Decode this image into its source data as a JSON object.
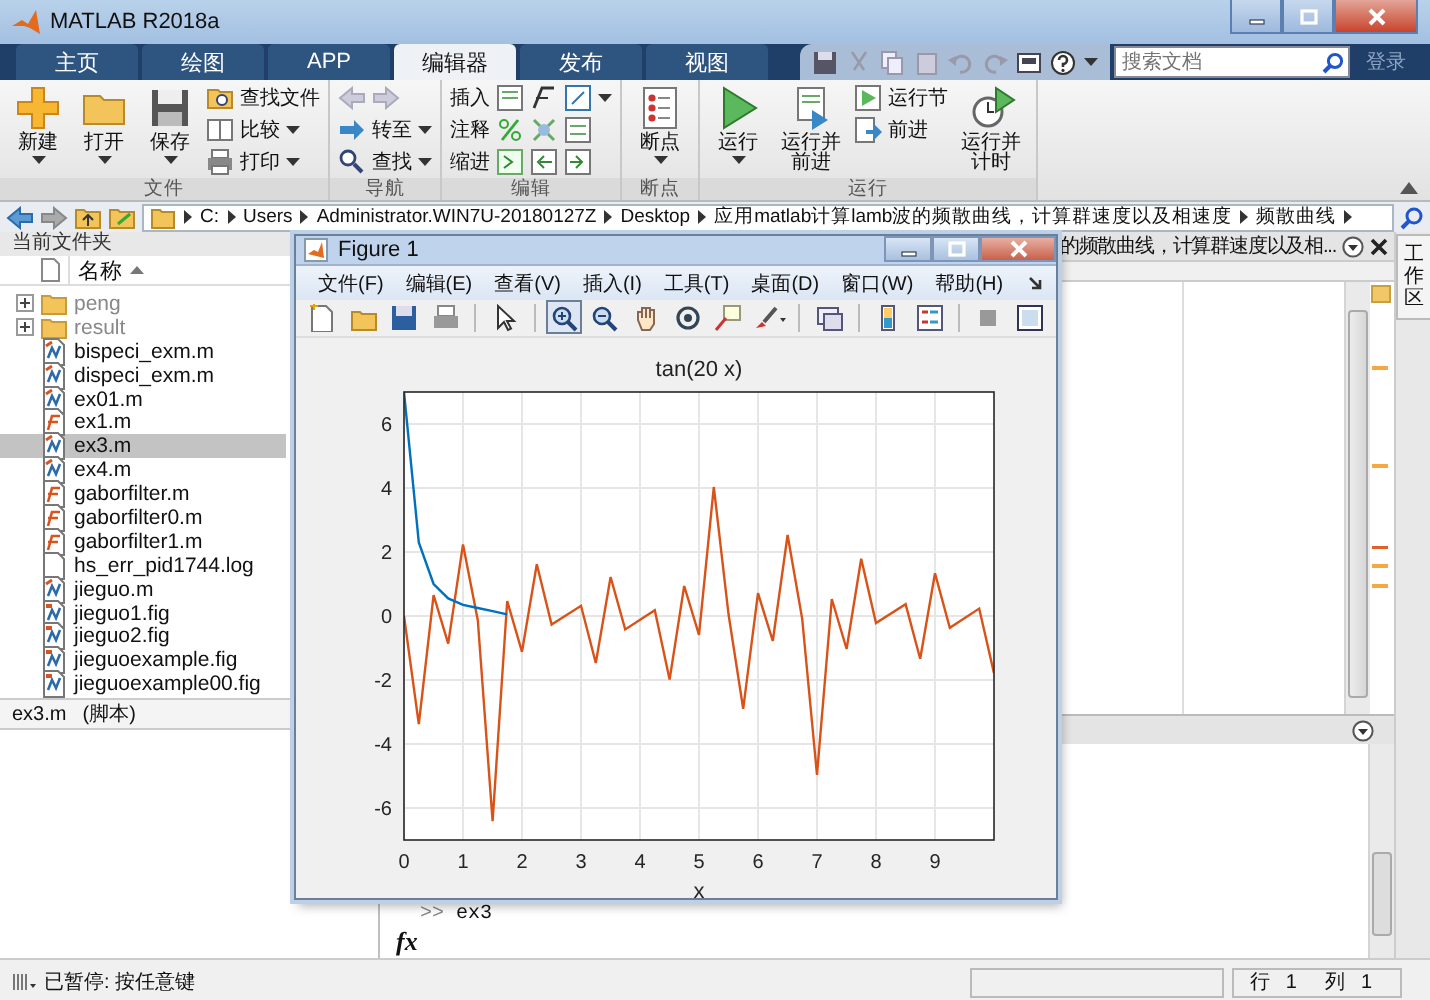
{
  "window": {
    "title": "MATLAB R2018a"
  },
  "tabs": [
    {
      "label": "主页",
      "selected": false
    },
    {
      "label": "绘图",
      "selected": false
    },
    {
      "label": "APP",
      "selected": false
    },
    {
      "label": "编辑器",
      "selected": true
    },
    {
      "label": "发布",
      "selected": false
    },
    {
      "label": "视图",
      "selected": false
    }
  ],
  "search": {
    "placeholder": "搜索文档"
  },
  "sign_in": "登录",
  "ribbon": [
    {
      "label": "文件",
      "items": [
        {
          "kind": "large",
          "label": "新建",
          "dropdown": true
        },
        {
          "kind": "large",
          "label": "打开",
          "dropdown": true
        },
        {
          "kind": "large",
          "label": "保存",
          "dropdown": true
        },
        {
          "kind": "small",
          "label": "查找文件",
          "dropdown": false
        },
        {
          "kind": "small",
          "label": "比较",
          "dropdown": true
        },
        {
          "kind": "small",
          "label": "打印",
          "dropdown": true
        }
      ]
    },
    {
      "label": "导航",
      "items": [
        {
          "kind": "arrows"
        },
        {
          "kind": "small",
          "label": "转至",
          "dropdown": true
        },
        {
          "kind": "small",
          "label": "查找",
          "dropdown": true
        }
      ]
    },
    {
      "label": "编辑",
      "items": [
        {
          "kind": "tools",
          "label": "插入",
          "dropdown": true
        },
        {
          "kind": "tools",
          "label": "注释",
          "dropdown": false
        },
        {
          "kind": "tools",
          "label": "缩进",
          "dropdown": false
        }
      ]
    },
    {
      "label": "断点",
      "items": [
        {
          "kind": "large",
          "label": "断点",
          "dropdown": true
        }
      ]
    },
    {
      "label": "运行",
      "items": [
        {
          "kind": "large",
          "label": "运行",
          "dropdown": true
        },
        {
          "kind": "large",
          "label": "运行并前进",
          "dropdown": false
        },
        {
          "kind": "small",
          "label": "运行节",
          "dropdown": false
        },
        {
          "kind": "small",
          "label": "前进",
          "dropdown": false
        },
        {
          "kind": "large",
          "label": "运行并计时",
          "dropdown": false
        }
      ]
    }
  ],
  "address_bar": {
    "path": [
      "C:",
      "Users",
      "Administrator.WIN7U-20180127Z",
      "Desktop",
      "应用matlab计算lamb波的频散曲线，计算群速度以及相速度",
      "频散曲线"
    ]
  },
  "current_folder": {
    "title": "当前文件夹",
    "column": "名称",
    "files": [
      {
        "name": "peng",
        "kind": "folder",
        "selected": false
      },
      {
        "name": "result",
        "kind": "folder",
        "selected": false
      },
      {
        "name": "bispeci_exm.m",
        "kind": "script",
        "selected": false
      },
      {
        "name": "dispeci_exm.m",
        "kind": "script",
        "selected": false
      },
      {
        "name": "ex01.m",
        "kind": "script",
        "selected": false
      },
      {
        "name": "ex1.m",
        "kind": "function",
        "selected": false
      },
      {
        "name": "ex3.m",
        "kind": "script",
        "selected": true
      },
      {
        "name": "ex4.m",
        "kind": "script",
        "selected": false
      },
      {
        "name": "gaborfilter.m",
        "kind": "function",
        "selected": false
      },
      {
        "name": "gaborfilter0.m",
        "kind": "function",
        "selected": false
      },
      {
        "name": "gaborfilter1.m",
        "kind": "function",
        "selected": false
      },
      {
        "name": "hs_err_pid1744.log",
        "kind": "text",
        "selected": false
      },
      {
        "name": "jieguo.m",
        "kind": "script",
        "selected": false
      },
      {
        "name": "jieguo1.fig",
        "kind": "figure",
        "selected": false
      },
      {
        "name": "jieguo2.fig",
        "kind": "figure",
        "selected": false
      },
      {
        "name": "jieguoexample.fig",
        "kind": "figure",
        "selected": false
      },
      {
        "name": "jieguoexample00.fig",
        "kind": "figure",
        "selected": false
      }
    ],
    "details": {
      "name": "ex3.m",
      "type": "(脚本)"
    }
  },
  "editor": {
    "tab_title": "的频散曲线，计算群速度以及相..."
  },
  "workspace_tab": "工作区",
  "command_window": {
    "prompt": ">>",
    "command": "ex3",
    "fx": "fx"
  },
  "status_bar": {
    "message": "已暂停: 按任意键",
    "row_label": "行",
    "row": "1",
    "col_label": "列",
    "col": "1"
  },
  "figure": {
    "title": "Figure 1",
    "menus": [
      "文件(F)",
      "编辑(E)",
      "查看(V)",
      "插入(I)",
      "工具(T)",
      "桌面(D)",
      "窗口(W)",
      "帮助(H)"
    ],
    "toolbar": [
      [
        {
          "kind": "new",
          "pressed": false
        },
        {
          "kind": "open",
          "pressed": false
        },
        {
          "kind": "save",
          "pressed": false
        },
        {
          "kind": "print",
          "pressed": false
        }
      ],
      [
        {
          "kind": "pointer",
          "pressed": false
        }
      ],
      [
        {
          "kind": "zoom_in",
          "pressed": true
        },
        {
          "kind": "zoom_out",
          "pressed": false
        },
        {
          "kind": "pan",
          "pressed": false
        },
        {
          "kind": "rotate",
          "pressed": false
        },
        {
          "kind": "data_cursor",
          "pressed": false
        },
        {
          "kind": "brush",
          "pressed": false
        }
      ],
      [
        {
          "kind": "link",
          "pressed": false
        }
      ],
      [
        {
          "kind": "colorbar",
          "pressed": false
        },
        {
          "kind": "legend",
          "pressed": false
        }
      ],
      [
        {
          "kind": "hide_tools",
          "pressed": false
        },
        {
          "kind": "show_tools",
          "pressed": false
        }
      ]
    ],
    "chart_data": {
      "type": "line",
      "title": "tan(20 x)",
      "xlabel": "x",
      "x": [
        0,
        0.25,
        0.5,
        0.75,
        1,
        1.25,
        1.5,
        1.75,
        2,
        2.25,
        2.5,
        3,
        3.25,
        3.5,
        3.75,
        4.25,
        4.5,
        4.75,
        5,
        5.25,
        5.5,
        5.75,
        6,
        6.25,
        6.5,
        6.75,
        7,
        7.25,
        7.5,
        7.75,
        8,
        8.5,
        8.75,
        9,
        9.25,
        9.75,
        10
      ],
      "series": [
        {
          "color": "#d95319",
          "values": [
            0,
            -3.38,
            0.65,
            -0.86,
            2.24,
            -0.13,
            -6.41,
            0.47,
            -1.12,
            1.62,
            -0.27,
            0.32,
            -1.47,
            1.22,
            -0.42,
            0.18,
            -1.99,
            0.94,
            -0.59,
            4.03,
            0.04,
            -2.9,
            0.71,
            -0.78,
            2.53,
            -0.09,
            -4.96,
            0.53,
            -1.03,
            1.79,
            -0.22,
            0.37,
            -1.34,
            1.34,
            -0.37,
            0.23,
            -1.79
          ]
        },
        {
          "color": "#0072bd",
          "values": [
            7,
            2.3,
            1.0,
            0.55,
            0.35,
            0.25,
            0.15,
            0.05,
            null,
            null,
            null,
            null,
            null,
            null,
            null,
            null,
            null,
            null,
            null,
            null,
            null,
            null,
            null,
            null,
            null,
            null,
            null,
            null,
            null,
            null,
            null,
            null,
            null,
            null,
            null,
            null,
            null
          ]
        }
      ],
      "grid": true,
      "xlim": [
        0,
        10
      ],
      "ylim": [
        -7,
        7
      ],
      "xticks": [
        0,
        1,
        2,
        3,
        4,
        5,
        6,
        7,
        8,
        9
      ],
      "yticks": [
        -6,
        -4,
        -2,
        0,
        2,
        4,
        6
      ]
    }
  }
}
